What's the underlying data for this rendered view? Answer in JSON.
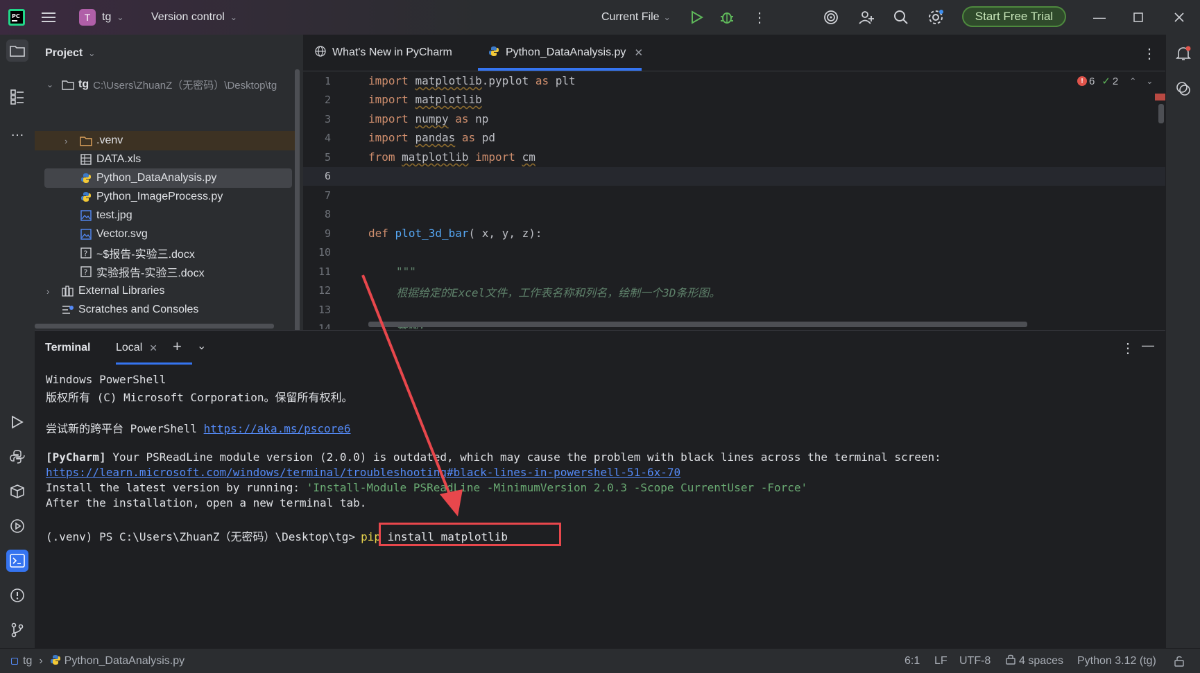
{
  "titlebar": {
    "project_initial": "T",
    "project_name": "tg",
    "vcs_label": "Version control",
    "run_config": "Current File",
    "trial_button": "Start Free Trial",
    "accent_color": "#4e8a3e"
  },
  "project_panel": {
    "title": "Project",
    "root_name": "tg",
    "root_path": "C:\\Users\\ZhuanZ（无密码）\\Desktop\\tg",
    "items": [
      {
        "label": ".venv"
      },
      {
        "label": "DATA.xls"
      },
      {
        "label": "Python_DataAnalysis.py"
      },
      {
        "label": "Python_ImageProcess.py"
      },
      {
        "label": "test.jpg"
      },
      {
        "label": "Vector.svg"
      },
      {
        "label": "~$报告-实验三.docx"
      },
      {
        "label": "实验报告-实验三.docx"
      }
    ],
    "external_libraries": "External Libraries",
    "scratches": "Scratches and Consoles"
  },
  "editor": {
    "tabs": [
      {
        "label": "What's New in PyCharm"
      },
      {
        "label": "Python_DataAnalysis.py"
      }
    ],
    "error_count": "6",
    "warning_count": "2",
    "line_numbers": [
      "1",
      "2",
      "3",
      "4",
      "5",
      "6",
      "7",
      "8",
      "9",
      "10",
      "11",
      "12",
      "13",
      "14"
    ],
    "code": {
      "l1": {
        "kw1": "import",
        "mod": "matplotlib",
        "rest": ".pyplot ",
        "kw2": "as",
        "alias": " plt"
      },
      "l2": {
        "kw1": "import",
        "mod": "matplotlib"
      },
      "l3": {
        "kw1": "import",
        "mod": "numpy",
        "kw2": "as",
        "alias": " np"
      },
      "l4": {
        "kw1": "import",
        "mod": "pandas",
        "kw2": "as",
        "alias": " pd"
      },
      "l5": {
        "kw1": "from",
        "mod": "matplotlib",
        "kw2": "import",
        "alias": "cm"
      },
      "l9": {
        "kw": "def",
        "fn": "plot_3d_bar",
        "args": "( x, y, z):"
      },
      "l11": "\"\"\"",
      "l12": "根据给定的Excel文件，工作表名称和列名，绘制一个3D条形图。",
      "l14": "参数:"
    }
  },
  "terminal": {
    "title": "Terminal",
    "tab_label": "Local",
    "lines": {
      "l1": "Windows PowerShell",
      "l2": "版权所有 (C) Microsoft Corporation。保留所有权利。",
      "l3_prefix": "尝试新的跨平台 PowerShell ",
      "l3_link": "https://aka.ms/pscore6",
      "l4_tag": "[PyCharm]",
      "l4_text": " Your PSReadLine module version (2.0.0) is outdated, which may cause the problem with black lines across the terminal screen:",
      "l5_link": "https://learn.microsoft.com/windows/terminal/troubleshooting#black-lines-in-powershell-51-6x-70",
      "l6_prefix": "Install the latest version by running: ",
      "l6_cmd": "'Install-Module PSReadLine -MinimumVersion 2.0.3 -Scope CurrentUser -Force'",
      "l7": "After the installation, open a new terminal tab.",
      "prompt": "(.venv) PS C:\\Users\\ZhuanZ（无密码）\\Desktop\\tg>",
      "cmd_pip": "pip",
      "cmd_rest": " install matplotlib"
    }
  },
  "statusbar": {
    "breadcrumb_root": "tg",
    "breadcrumb_file": "Python_DataAnalysis.py",
    "position": "6:1",
    "line_sep": "LF",
    "encoding": "UTF-8",
    "indent": "4 spaces",
    "interpreter": "Python 3.12 (tg)"
  },
  "annotation": {
    "color": "#e8474c"
  }
}
